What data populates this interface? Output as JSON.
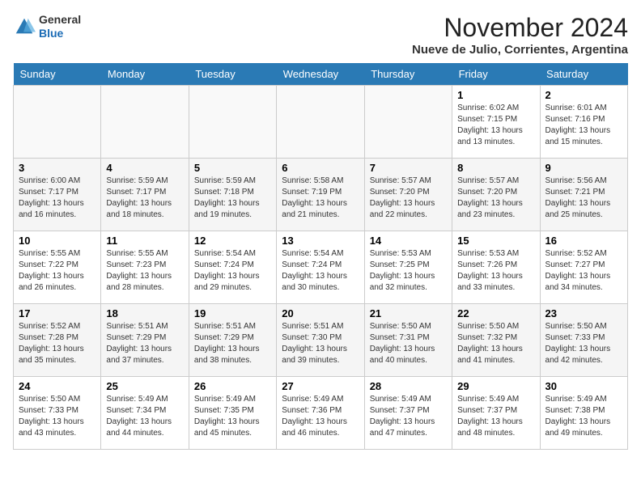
{
  "header": {
    "logo_line1": "General",
    "logo_line2": "Blue",
    "month_title": "November 2024",
    "location": "Nueve de Julio, Corrientes, Argentina"
  },
  "weekdays": [
    "Sunday",
    "Monday",
    "Tuesday",
    "Wednesday",
    "Thursday",
    "Friday",
    "Saturday"
  ],
  "weeks": [
    [
      {
        "day": "",
        "info": ""
      },
      {
        "day": "",
        "info": ""
      },
      {
        "day": "",
        "info": ""
      },
      {
        "day": "",
        "info": ""
      },
      {
        "day": "",
        "info": ""
      },
      {
        "day": "1",
        "info": "Sunrise: 6:02 AM\nSunset: 7:15 PM\nDaylight: 13 hours\nand 13 minutes."
      },
      {
        "day": "2",
        "info": "Sunrise: 6:01 AM\nSunset: 7:16 PM\nDaylight: 13 hours\nand 15 minutes."
      }
    ],
    [
      {
        "day": "3",
        "info": "Sunrise: 6:00 AM\nSunset: 7:17 PM\nDaylight: 13 hours\nand 16 minutes."
      },
      {
        "day": "4",
        "info": "Sunrise: 5:59 AM\nSunset: 7:17 PM\nDaylight: 13 hours\nand 18 minutes."
      },
      {
        "day": "5",
        "info": "Sunrise: 5:59 AM\nSunset: 7:18 PM\nDaylight: 13 hours\nand 19 minutes."
      },
      {
        "day": "6",
        "info": "Sunrise: 5:58 AM\nSunset: 7:19 PM\nDaylight: 13 hours\nand 21 minutes."
      },
      {
        "day": "7",
        "info": "Sunrise: 5:57 AM\nSunset: 7:20 PM\nDaylight: 13 hours\nand 22 minutes."
      },
      {
        "day": "8",
        "info": "Sunrise: 5:57 AM\nSunset: 7:20 PM\nDaylight: 13 hours\nand 23 minutes."
      },
      {
        "day": "9",
        "info": "Sunrise: 5:56 AM\nSunset: 7:21 PM\nDaylight: 13 hours\nand 25 minutes."
      }
    ],
    [
      {
        "day": "10",
        "info": "Sunrise: 5:55 AM\nSunset: 7:22 PM\nDaylight: 13 hours\nand 26 minutes."
      },
      {
        "day": "11",
        "info": "Sunrise: 5:55 AM\nSunset: 7:23 PM\nDaylight: 13 hours\nand 28 minutes."
      },
      {
        "day": "12",
        "info": "Sunrise: 5:54 AM\nSunset: 7:24 PM\nDaylight: 13 hours\nand 29 minutes."
      },
      {
        "day": "13",
        "info": "Sunrise: 5:54 AM\nSunset: 7:24 PM\nDaylight: 13 hours\nand 30 minutes."
      },
      {
        "day": "14",
        "info": "Sunrise: 5:53 AM\nSunset: 7:25 PM\nDaylight: 13 hours\nand 32 minutes."
      },
      {
        "day": "15",
        "info": "Sunrise: 5:53 AM\nSunset: 7:26 PM\nDaylight: 13 hours\nand 33 minutes."
      },
      {
        "day": "16",
        "info": "Sunrise: 5:52 AM\nSunset: 7:27 PM\nDaylight: 13 hours\nand 34 minutes."
      }
    ],
    [
      {
        "day": "17",
        "info": "Sunrise: 5:52 AM\nSunset: 7:28 PM\nDaylight: 13 hours\nand 35 minutes."
      },
      {
        "day": "18",
        "info": "Sunrise: 5:51 AM\nSunset: 7:29 PM\nDaylight: 13 hours\nand 37 minutes."
      },
      {
        "day": "19",
        "info": "Sunrise: 5:51 AM\nSunset: 7:29 PM\nDaylight: 13 hours\nand 38 minutes."
      },
      {
        "day": "20",
        "info": "Sunrise: 5:51 AM\nSunset: 7:30 PM\nDaylight: 13 hours\nand 39 minutes."
      },
      {
        "day": "21",
        "info": "Sunrise: 5:50 AM\nSunset: 7:31 PM\nDaylight: 13 hours\nand 40 minutes."
      },
      {
        "day": "22",
        "info": "Sunrise: 5:50 AM\nSunset: 7:32 PM\nDaylight: 13 hours\nand 41 minutes."
      },
      {
        "day": "23",
        "info": "Sunrise: 5:50 AM\nSunset: 7:33 PM\nDaylight: 13 hours\nand 42 minutes."
      }
    ],
    [
      {
        "day": "24",
        "info": "Sunrise: 5:50 AM\nSunset: 7:33 PM\nDaylight: 13 hours\nand 43 minutes."
      },
      {
        "day": "25",
        "info": "Sunrise: 5:49 AM\nSunset: 7:34 PM\nDaylight: 13 hours\nand 44 minutes."
      },
      {
        "day": "26",
        "info": "Sunrise: 5:49 AM\nSunset: 7:35 PM\nDaylight: 13 hours\nand 45 minutes."
      },
      {
        "day": "27",
        "info": "Sunrise: 5:49 AM\nSunset: 7:36 PM\nDaylight: 13 hours\nand 46 minutes."
      },
      {
        "day": "28",
        "info": "Sunrise: 5:49 AM\nSunset: 7:37 PM\nDaylight: 13 hours\nand 47 minutes."
      },
      {
        "day": "29",
        "info": "Sunrise: 5:49 AM\nSunset: 7:37 PM\nDaylight: 13 hours\nand 48 minutes."
      },
      {
        "day": "30",
        "info": "Sunrise: 5:49 AM\nSunset: 7:38 PM\nDaylight: 13 hours\nand 49 minutes."
      }
    ]
  ]
}
